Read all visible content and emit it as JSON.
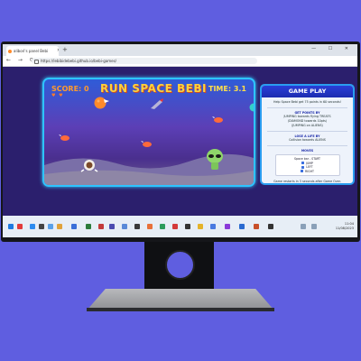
{
  "browser": {
    "tab_title": "alibori's panel Bebi",
    "new_tab": "+",
    "window_controls": "— ☐ ✕",
    "nav": "← → ⟳",
    "url": "https://lebibidebebi.github.io/bebi-games/"
  },
  "game": {
    "score_label": "SCORE: 0",
    "title": "RUN SPACE BEBI",
    "time_label": "TIME: 3.1",
    "lives": "♥ ♥"
  },
  "sidebar": {
    "heading": "GAME PLAY",
    "intro": "Help Space Bebi get 75 points in 60 seconds!",
    "points_heading": "GET POINTS BY",
    "points_lines": [
      "JUMPING towards flying TREATS",
      "(DIAMOND towards 10pts)",
      "(JUMPING on ALIENS)"
    ],
    "lose_heading": "LOSE A LIFE BY",
    "lose_lines": [
      "Collision towards ALIENS"
    ],
    "moves_heading": "MOVES",
    "moves_intro": "Space bar - START",
    "keys": [
      "JUMP",
      "LEFT",
      "RIGHT"
    ],
    "footer": "Game restarts in 3 seconds after Game Over."
  },
  "taskbar": {
    "time": "11:04",
    "date": "11/08/2023"
  },
  "colors": {
    "background": "#5f5ee0",
    "accent": "#2ec4ff",
    "title": "#ffd23a"
  }
}
